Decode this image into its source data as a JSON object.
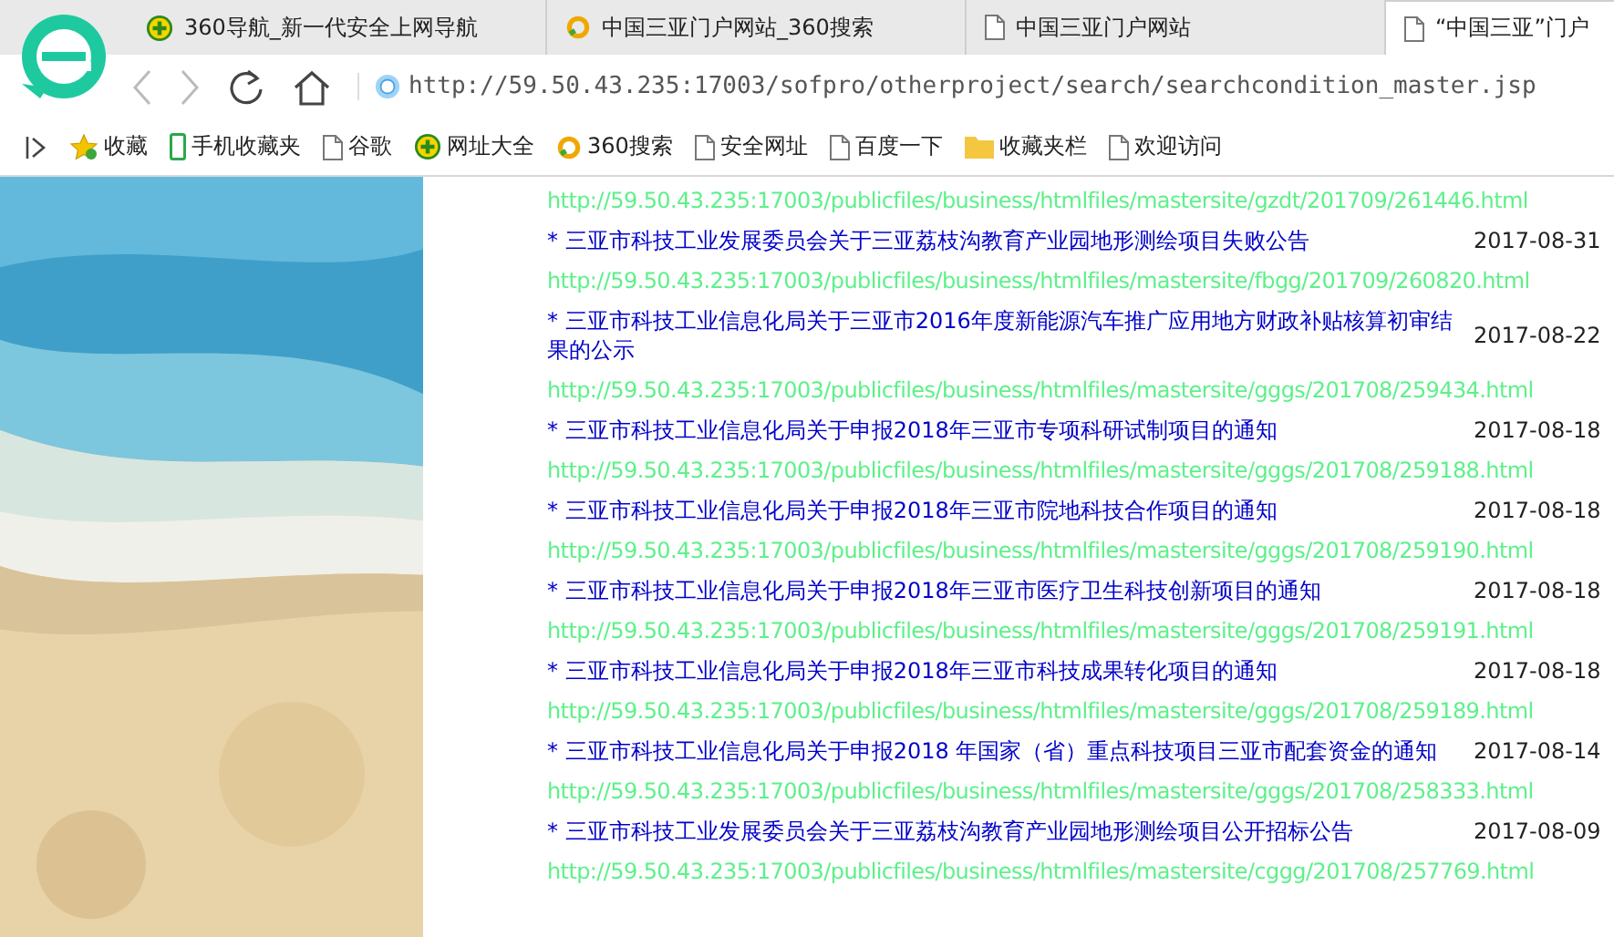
{
  "tabs": [
    {
      "title": "360导航_新一代安全上网导航",
      "kind": "plus",
      "selected": false
    },
    {
      "title": "中国三亚门户网站_360搜索",
      "kind": "search360",
      "selected": false
    },
    {
      "title": "中国三亚门户网站",
      "kind": "page",
      "selected": false
    },
    {
      "title": "“中国三亚”门户",
      "kind": "page",
      "selected": true
    }
  ],
  "address_bar": {
    "url": "http://59.50.43.235:17003/sofpro/otherproject/search/searchcondition_master.jsp"
  },
  "bookmarks": [
    {
      "label": "收藏",
      "kind": "star"
    },
    {
      "label": "手机收藏夹",
      "kind": "phone"
    },
    {
      "label": "谷歌",
      "kind": "page"
    },
    {
      "label": "网址大全",
      "kind": "plus"
    },
    {
      "label": "360搜索",
      "kind": "search360"
    },
    {
      "label": "安全网址",
      "kind": "page"
    },
    {
      "label": "百度一下",
      "kind": "page"
    },
    {
      "label": "收藏夹栏",
      "kind": "folder"
    },
    {
      "label": "欢迎访问",
      "kind": "page"
    }
  ],
  "results": [
    {
      "url": "http://59.50.43.235:17003/publicfiles/business/htmlfiles/mastersite/gzdt/201709/261446.html"
    },
    {
      "title": "* 三亚市科技工业发展委员会关于三亚荔枝沟教育产业园地形测绘项目失败公告",
      "date": "2017-08-31",
      "url": "http://59.50.43.235:17003/publicfiles/business/htmlfiles/mastersite/fbgg/201709/260820.html"
    },
    {
      "title": "* 三亚市科技工业信息化局关于三亚市2016年度新能源汽车推广应用地方财政补贴核算初审结果的公示",
      "date": "2017-08-22",
      "url": "http://59.50.43.235:17003/publicfiles/business/htmlfiles/mastersite/gggs/201708/259434.html"
    },
    {
      "title": "* 三亚市科技工业信息化局关于申报2018年三亚市专项科研试制项目的通知",
      "date": "2017-08-18",
      "url": "http://59.50.43.235:17003/publicfiles/business/htmlfiles/mastersite/gggs/201708/259188.html"
    },
    {
      "title": "* 三亚市科技工业信息化局关于申报2018年三亚市院地科技合作项目的通知",
      "date": "2017-08-18",
      "url": "http://59.50.43.235:17003/publicfiles/business/htmlfiles/mastersite/gggs/201708/259190.html"
    },
    {
      "title": "* 三亚市科技工业信息化局关于申报2018年三亚市医疗卫生科技创新项目的通知",
      "date": "2017-08-18",
      "url": "http://59.50.43.235:17003/publicfiles/business/htmlfiles/mastersite/gggs/201708/259191.html"
    },
    {
      "title": "* 三亚市科技工业信息化局关于申报2018年三亚市科技成果转化项目的通知",
      "date": "2017-08-18",
      "url": "http://59.50.43.235:17003/publicfiles/business/htmlfiles/mastersite/gggs/201708/259189.html"
    },
    {
      "title": "* 三亚市科技工业信息化局关于申报2018 年国家（省）重点科技项目三亚市配套资金的通知",
      "date": "2017-08-14",
      "url": "http://59.50.43.235:17003/publicfiles/business/htmlfiles/mastersite/gggs/201708/258333.html"
    },
    {
      "title": "* 三亚市科技工业发展委员会关于三亚荔枝沟教育产业园地形测绘项目公开招标公告",
      "date": "2017-08-09",
      "url": "http://59.50.43.235:17003/publicfiles/business/htmlfiles/mastersite/cggg/201708/257769.html"
    }
  ]
}
